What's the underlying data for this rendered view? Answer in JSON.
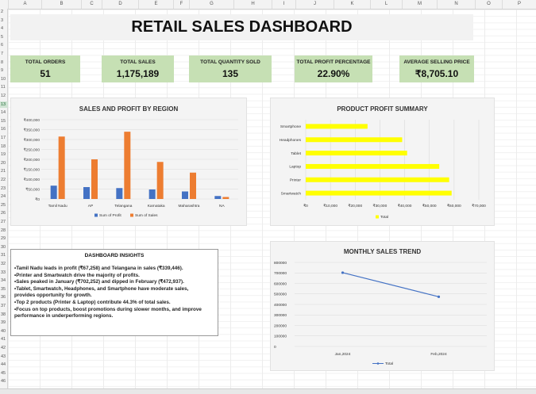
{
  "sheet": {
    "columns": [
      "A",
      "B",
      "C",
      "D",
      "E",
      "F",
      "G",
      "H",
      "I",
      "J",
      "K",
      "L",
      "M",
      "N",
      "O",
      "P"
    ],
    "rows": [
      "2",
      "3",
      "4",
      "5",
      "6",
      "7",
      "8",
      "9",
      "10",
      "11",
      "12",
      "13",
      "14",
      "15",
      "16",
      "17",
      "18",
      "19",
      "20",
      "21",
      "22",
      "23",
      "24",
      "25",
      "26",
      "27",
      "28",
      "29",
      "30",
      "31",
      "32",
      "33",
      "34",
      "35",
      "36",
      "37",
      "38",
      "39",
      "40",
      "41",
      "42",
      "43",
      "44",
      "45",
      "46"
    ],
    "selected_row": "13"
  },
  "dashboard": {
    "title": "RETAIL SALES DASHBOARD"
  },
  "kpis": [
    {
      "label": "TOTAL ORDERS",
      "value": "51"
    },
    {
      "label": "TOTAL SALES",
      "value": "1,175,189"
    },
    {
      "label": "TOTAL QUANTITY SOLD",
      "value": "135"
    },
    {
      "label": "TOTAL PROFIT PERCENTAGE",
      "value": "22.90%"
    },
    {
      "label": "AVERAGE SELLING PRICE",
      "value": "₹8,705.10"
    }
  ],
  "colors": {
    "kpi_bg": "#c6e0b4",
    "profit": "#4472c4",
    "sales": "#ed7d31",
    "product_bar": "#ffff00",
    "trend_line": "#4472c4"
  },
  "chart_data": [
    {
      "type": "bar",
      "title": "SALES AND PROFIT BY REGION",
      "categories": [
        "Tamil Nadu",
        "AP",
        "Telangana",
        "Karnataka",
        "Maharashtra",
        "NA"
      ],
      "series": [
        {
          "name": "Sum of Profit",
          "values": [
            67258,
            60000,
            55000,
            48000,
            38000,
            15000
          ]
        },
        {
          "name": "Sum of Sales",
          "values": [
            315000,
            200000,
            339446,
            187000,
            133000,
            10000
          ]
        }
      ],
      "ylim": [
        0,
        400000
      ],
      "yticks": [
        "₹0",
        "₹50,000",
        "₹100,000",
        "₹150,000",
        "₹200,000",
        "₹250,000",
        "₹300,000",
        "₹350,000",
        "₹400,000"
      ],
      "legend": "bottom",
      "grid": true
    },
    {
      "type": "bar",
      "orientation": "horizontal",
      "title": "PRODUCT PROFIT SUMMARY",
      "categories": [
        "Smartphone",
        "Headphones",
        "Tablet",
        "Laptop",
        "Printer",
        "Smartwatch"
      ],
      "series": [
        {
          "name": "Total",
          "values": [
            25000,
            39000,
            41000,
            54000,
            58000,
            59000
          ]
        }
      ],
      "xlim": [
        0,
        70000
      ],
      "xticks": [
        "₹0",
        "₹10,000",
        "₹20,000",
        "₹30,000",
        "₹40,000",
        "₹50,000",
        "₹60,000",
        "₹70,000"
      ],
      "legend": "bottom",
      "grid": true
    },
    {
      "type": "line",
      "title": "MONTHLY SALES TREND",
      "categories": [
        "Jan,2024",
        "Feb,2024"
      ],
      "series": [
        {
          "name": "Total",
          "values": [
            702252,
            472937
          ]
        }
      ],
      "ylim": [
        0,
        800000
      ],
      "yticks": [
        "0",
        "100000",
        "200000",
        "300000",
        "400000",
        "500000",
        "600000",
        "700000",
        "800000"
      ],
      "legend": "bottom",
      "grid": true
    }
  ],
  "insights": {
    "title": "DASHBOARD INSIGHTS",
    "lines": [
      "•Tamil Nadu leads in profit (₹67,258) and Telangana in sales (₹339,446).",
      "•Printer and Smartwatch drive the majority of profits.",
      "•Sales peaked in January (₹702,252) and dipped in February (₹472,937).",
      "•Tablet, Smartwatch, Headphones, and Smartphone have moderate sales,",
      "provides opportunity for growth.",
      "•Top 2 products (Printer & Laptop) contribute 44.3% of total sales.",
      "•Focus on top products, boost promotions during slower months, and improve",
      "performance in underperforming regions."
    ]
  }
}
